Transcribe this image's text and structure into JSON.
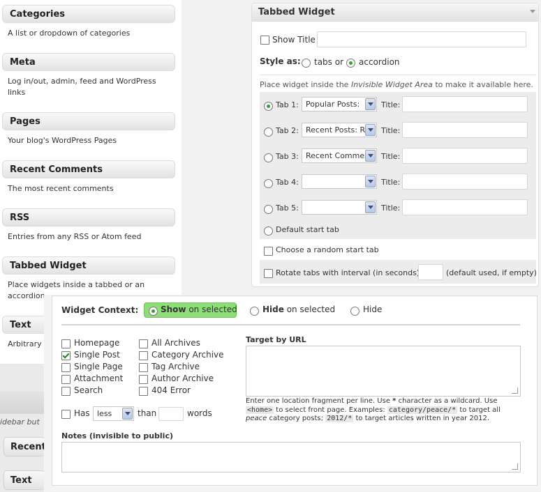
{
  "widgets": [
    {
      "title": "Categories",
      "desc": "A list or dropdown of categories"
    },
    {
      "title": "Meta",
      "desc": "Log in/out, admin, feed and WordPress links"
    },
    {
      "title": "Pages",
      "desc": "Your blog's WordPress Pages"
    },
    {
      "title": "Recent Comments",
      "desc": "The most recent comments"
    },
    {
      "title": "RSS",
      "desc": "Entries from any RSS or Atom feed"
    },
    {
      "title": "Tabbed Widget",
      "desc": "Place widgets inside a tabbed or an accordion"
    },
    {
      "title": "Text",
      "desc": "Arbitrary t"
    }
  ],
  "sidebar_hint": "idebar but",
  "mini_widgets": [
    "Recent",
    "Text"
  ],
  "tabbed": {
    "title": "Tabbed Widget",
    "show_title": "Show Title",
    "style_as": "Style as",
    "tabs_label": "tabs or",
    "accordion_label": "accordion",
    "hint_prefix": "Place widget inside the ",
    "hint_em": "Invisible Widget Area",
    "hint_suffix": " to make it available here.",
    "tabs": [
      {
        "label": "Tab 1:",
        "select": "Popular Posts:",
        "title_label": "Title:"
      },
      {
        "label": "Tab 2:",
        "select": "Recent Posts: R",
        "title_label": "Title:"
      },
      {
        "label": "Tab 3:",
        "select": "Recent Comme",
        "title_label": "Title:"
      },
      {
        "label": "Tab 4:",
        "select": "",
        "title_label": "Title:"
      },
      {
        "label": "Tab 5:",
        "select": "",
        "title_label": "Title:"
      }
    ],
    "default_start": "Default start tab",
    "random_start": "Choose a random start tab",
    "rotate": "Rotate tabs with interval (in seconds):",
    "rotate_hint": "(default used, if empty)"
  },
  "context": {
    "label": "Widget Context:",
    "show_bold": "Show",
    "show_rest": " on selected",
    "hide_bold": "Hide",
    "hide_rest": " on selected",
    "hide_plain": "Hide",
    "left_checks": [
      "Homepage",
      "Single Post",
      "Single Page",
      "Attachment",
      "Search"
    ],
    "right_checks": [
      "All Archives",
      "Category Archive",
      "Tag Archive",
      "Author Archive",
      "404 Error"
    ],
    "has": "Has",
    "compare": "less",
    "than": "than",
    "words": "words",
    "target_title": "Target by URL",
    "note_1": "Enter one location fragment per line. Use ",
    "note_star": "*",
    "note_2": " character as a wildcard. Use",
    "note_home": "<home>",
    "note_3": " to select front page. Examples: ",
    "note_cat": "category/peace/*",
    "note_4": " to target all",
    "note_peace": "peace",
    "note_5": " category posts; ",
    "note_year": "2012/*",
    "note_6": " to target articles written in year 2012.",
    "notes_title": "Notes (invisible to public)"
  }
}
